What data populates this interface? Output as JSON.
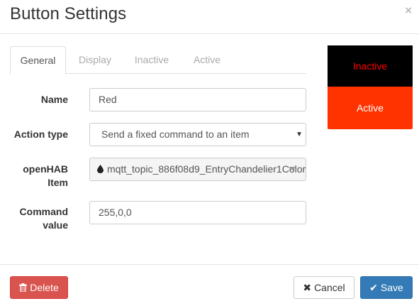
{
  "dialog": {
    "title": "Button Settings",
    "close_icon": "×"
  },
  "tabs": [
    {
      "label": "General",
      "active": true
    },
    {
      "label": "Display",
      "active": false
    },
    {
      "label": "Inactive",
      "active": false
    },
    {
      "label": "Active",
      "active": false
    }
  ],
  "form": {
    "name_label": "Name",
    "name_value": "Red",
    "action_label": "Action type",
    "action_value": "Send a fixed command to an item",
    "item_label_line1": "openHAB",
    "item_label_line2": "Item",
    "item_icon": "droplet-icon",
    "item_value": "mqtt_topic_886f08d9_EntryChandelier1Color",
    "command_label_line1": "Command",
    "command_label_line2": "value",
    "command_value": "255,0,0"
  },
  "preview": {
    "inactive_label": "Inactive",
    "active_label": "Active",
    "inactive_bg": "#000000",
    "inactive_fg": "#ff0000",
    "active_bg": "#ff3300",
    "active_fg": "#ffffff"
  },
  "footer": {
    "delete_label": "Delete",
    "cancel_label": "Cancel",
    "save_label": "Save",
    "delete_icon": "trash-icon",
    "cancel_icon": "close-icon",
    "save_icon": "check-icon"
  }
}
